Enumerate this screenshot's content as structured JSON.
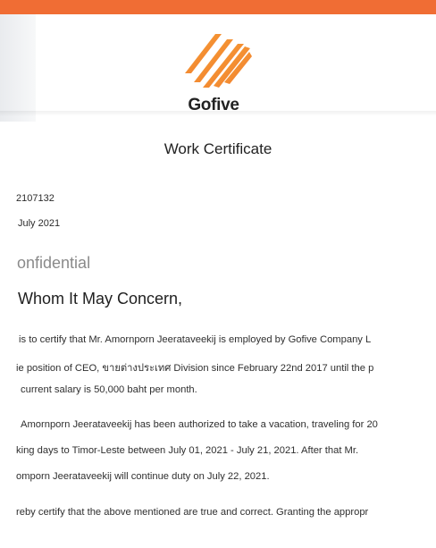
{
  "brand": {
    "name": "Gofive",
    "colors": {
      "accent": "#f06d34",
      "logo_light": "#f8b133",
      "logo_dark": "#ef6b30"
    }
  },
  "document": {
    "title": "Work Certificate",
    "ref_number": "2107132",
    "date": "July 2021",
    "confidential": "onfidential",
    "salutation": "Whom It May Concern,",
    "paragraphs": [
      [
        "is to certify that Mr. Amornporn Jeerataveekij is employed by Gofive Company L",
        "ie position of CEO, ขายต่างประเทศ Division since February 22nd 2017 until the p",
        "current salary is 50,000 baht per month."
      ],
      [
        "Amornporn Jeerataveekij has been authorized to take a vacation, traveling for 20",
        "king days to Timor-Leste between July 01, 2021 - July 21, 2021. After that Mr.",
        "omporn Jeerataveekij will continue duty on July 22, 2021."
      ],
      [
        "reby certify that the above mentioned are true and correct. Granting the appropr"
      ]
    ]
  }
}
